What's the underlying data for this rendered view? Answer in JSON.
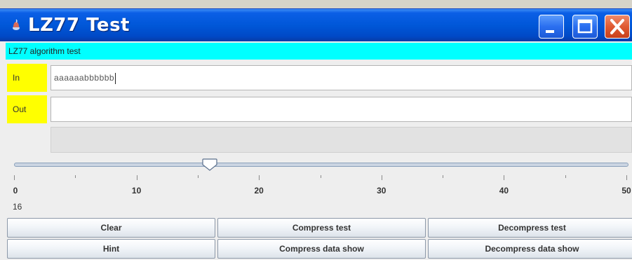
{
  "window": {
    "title": "LZ77 Test"
  },
  "header": {
    "subtitle": "LZ77 algorithm test"
  },
  "input": {
    "label": "In",
    "value": "aaaaaabbbbbb"
  },
  "output": {
    "label": "Out",
    "value": ""
  },
  "slider": {
    "value": 16,
    "value_text": "16",
    "min": 0,
    "max": 50,
    "tick_labels": [
      "0",
      "10",
      "20",
      "30",
      "40",
      "50"
    ]
  },
  "buttons": {
    "clear": "Clear",
    "compress_test": "Compress test",
    "decompress_test": "Decompress test",
    "hint": "Hint",
    "compress_data_show": "Compress data show",
    "decompress_data_show": "Decompress data show"
  },
  "colors": {
    "titlebar": "#0057d8",
    "subtitle_bg": "#00ffff",
    "label_bg": "#ffff00"
  },
  "icons": {
    "app": "java-cup-icon",
    "minimize": "minimize-icon",
    "maximize": "maximize-icon",
    "close": "close-icon"
  }
}
